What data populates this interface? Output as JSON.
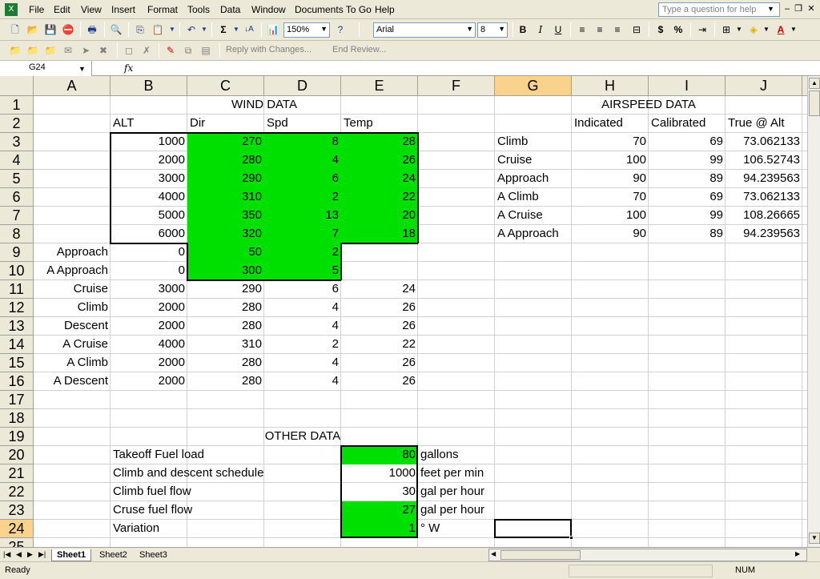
{
  "menu": {
    "items": [
      "File",
      "Edit",
      "View",
      "Insert",
      "Format",
      "Tools",
      "Data",
      "Window",
      "Documents To Go",
      "Help"
    ],
    "help_placeholder": "Type a question for help"
  },
  "toolbar": {
    "zoom": "150%",
    "font": "Arial",
    "font_size": "8",
    "reply_with_changes": "Reply with Changes...",
    "end_review": "End Review...",
    "sigma": "Σ",
    "bold": "B",
    "italic": "I",
    "underline": "U",
    "dollar": "$",
    "percent": "%"
  },
  "formula_bar": {
    "name_box": "G24",
    "fx": "fx"
  },
  "columns": [
    "A",
    "B",
    "C",
    "D",
    "E",
    "F",
    "G",
    "H",
    "I",
    "J"
  ],
  "selected_column": "G",
  "rows": [
    "1",
    "2",
    "3",
    "4",
    "5",
    "6",
    "7",
    "8",
    "9",
    "10",
    "11",
    "12",
    "13",
    "14",
    "15",
    "16",
    "17",
    "18",
    "19",
    "20",
    "21",
    "22",
    "23",
    "24",
    "25"
  ],
  "selected_row": "24",
  "sheet": {
    "wind_title": "WIND DATA",
    "airspeed_title": "AIRSPEED DATA",
    "other_title": "OTHER DATA",
    "wind_headers": [
      "ALT",
      "Dir",
      "Spd",
      "Temp"
    ],
    "airspeed_headers": [
      "Indicated",
      "Calibrated",
      "True @ Alt"
    ],
    "wind_rows": [
      [
        "1000",
        "270",
        "8",
        "28"
      ],
      [
        "2000",
        "280",
        "4",
        "26"
      ],
      [
        "3000",
        "290",
        "6",
        "24"
      ],
      [
        "4000",
        "310",
        "2",
        "22"
      ],
      [
        "5000",
        "350",
        "13",
        "20"
      ],
      [
        "6000",
        "320",
        "7",
        "18"
      ]
    ],
    "phase_rows": [
      [
        "Approach",
        "0",
        "50",
        "2",
        ""
      ],
      [
        "A Approach",
        "0",
        "300",
        "5",
        ""
      ],
      [
        "Cruise",
        "3000",
        "290",
        "6",
        "24"
      ],
      [
        "Climb",
        "2000",
        "280",
        "4",
        "26"
      ],
      [
        "Descent",
        "2000",
        "280",
        "4",
        "26"
      ],
      [
        "A Cruise",
        "4000",
        "310",
        "2",
        "22"
      ],
      [
        "A Climb",
        "2000",
        "280",
        "4",
        "26"
      ],
      [
        "A Descent",
        "2000",
        "280",
        "4",
        "26"
      ]
    ],
    "airspeed_rows": [
      [
        "Climb",
        "70",
        "69",
        "73.062133"
      ],
      [
        "Cruise",
        "100",
        "99",
        "106.52743"
      ],
      [
        "Approach",
        "90",
        "89",
        "94.239563"
      ],
      [
        "A Climb",
        "70",
        "69",
        "73.062133"
      ],
      [
        "A Cruise",
        "100",
        "99",
        "108.26665"
      ],
      [
        "A Approach",
        "90",
        "89",
        "94.239563"
      ]
    ],
    "other_rows": [
      [
        "Takeoff Fuel load",
        "80",
        "gallons"
      ],
      [
        "Climb and descent schedule",
        "1000",
        "feet per min"
      ],
      [
        "Climb fuel flow",
        "30",
        "gal per hour"
      ],
      [
        "Cruse fuel flow",
        "27",
        "gal per hour"
      ],
      [
        "Variation",
        "1",
        "° W"
      ]
    ]
  },
  "tabs": [
    "Sheet1",
    "Sheet2",
    "Sheet3"
  ],
  "status": {
    "ready": "Ready",
    "num": "NUM"
  },
  "colors": {
    "green_fill": "#00e000",
    "selected_header": "#f9d38c"
  }
}
